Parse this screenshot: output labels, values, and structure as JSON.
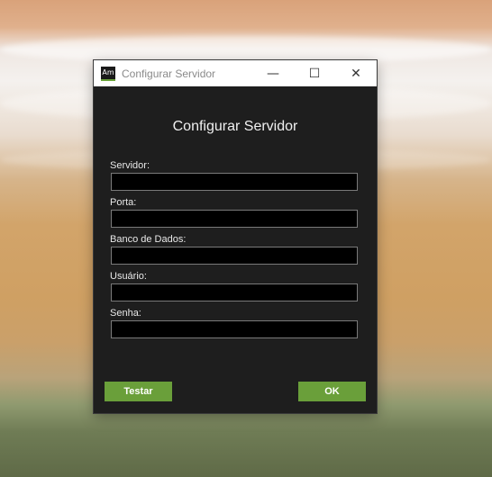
{
  "window": {
    "title": "Configurar Servidor",
    "icon_text": "Am",
    "controls": {
      "minimize": "—",
      "maximize": "☐",
      "close": "✕"
    }
  },
  "form": {
    "heading": "Configurar Servidor",
    "fields": [
      {
        "label": "Servidor:",
        "value": ""
      },
      {
        "label": "Porta:",
        "value": ""
      },
      {
        "label": "Banco de Dados:",
        "value": ""
      },
      {
        "label": "Usuário:",
        "value": ""
      },
      {
        "label": "Senha:",
        "value": ""
      }
    ]
  },
  "buttons": {
    "test": "Testar",
    "ok": "OK"
  },
  "colors": {
    "accent": "#6a9f3a",
    "dialog_bg": "#1e1e1e",
    "input_bg": "#000000"
  }
}
